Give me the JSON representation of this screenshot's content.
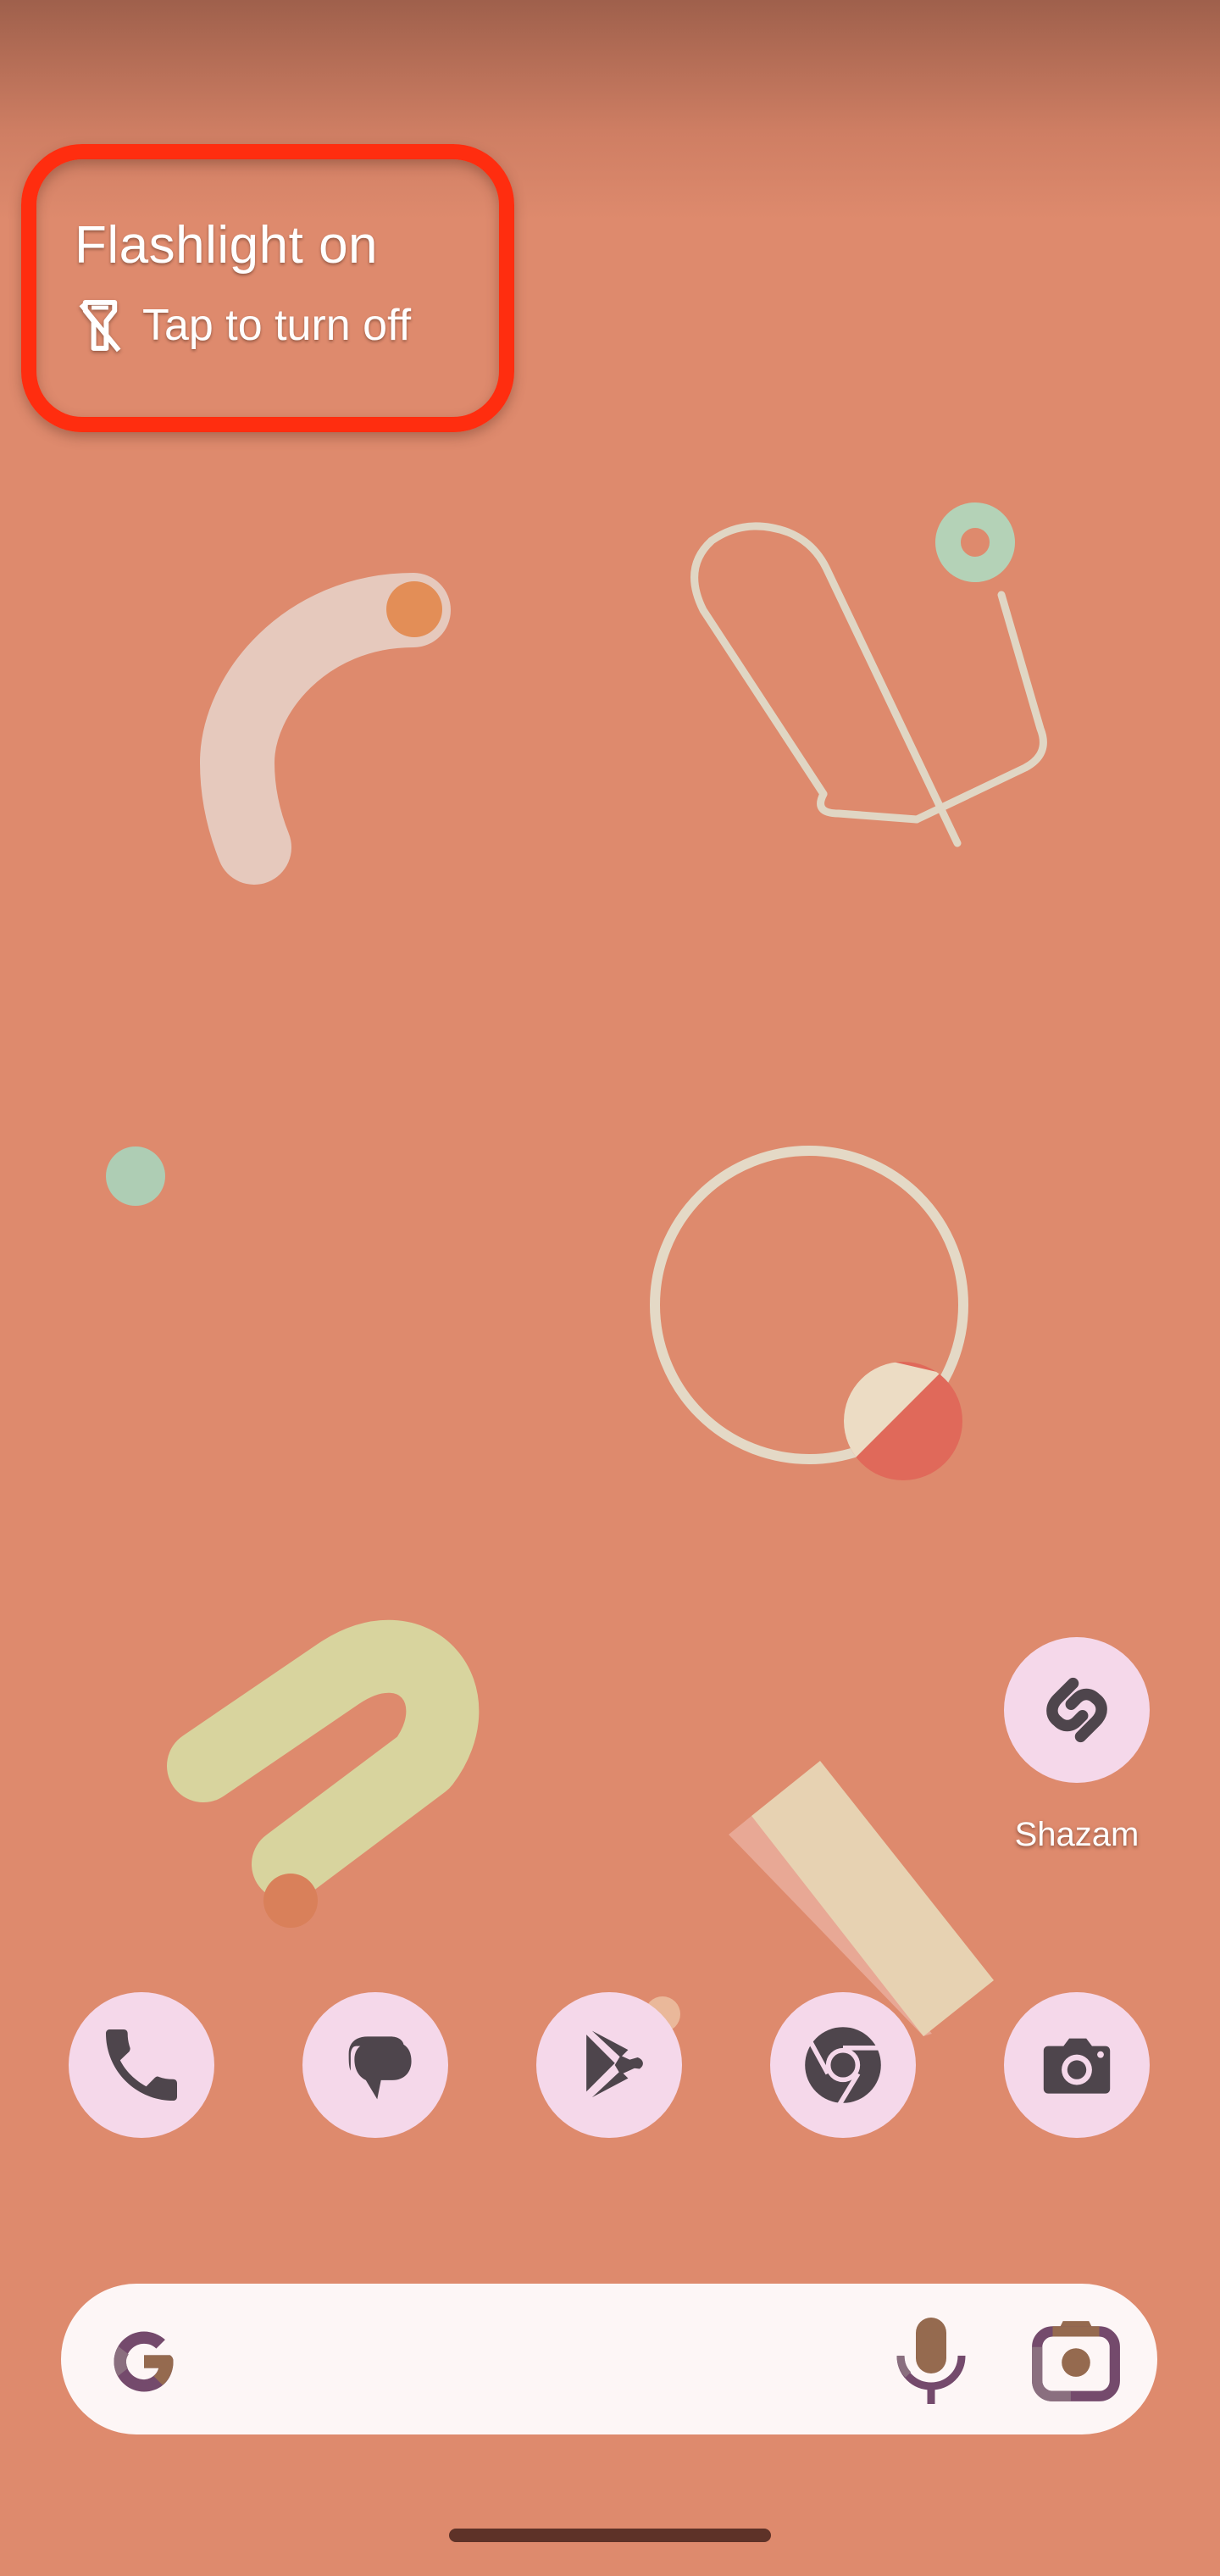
{
  "screen": "Android home screen",
  "colors": {
    "wallpaper_bg": "#de8a6d",
    "highlight_border": "#ff2d0f",
    "icon_bg": "#f5d8ea",
    "icon_fg": "#4e454c",
    "search_bg": "#fdf6f6"
  },
  "notification": {
    "title": "Flashlight on",
    "action_text": "Tap to turn off",
    "icon": "flashlight-off-icon",
    "highlighted": true
  },
  "home_apps": [
    {
      "label": "Shazam",
      "icon": "shazam-icon"
    }
  ],
  "dock": [
    {
      "name": "Phone",
      "icon": "phone-icon"
    },
    {
      "name": "Messages",
      "icon": "messages-icon"
    },
    {
      "name": "Play Store",
      "icon": "play-store-icon"
    },
    {
      "name": "Chrome",
      "icon": "chrome-icon"
    },
    {
      "name": "Camera",
      "icon": "camera-icon"
    }
  ],
  "search_bar": {
    "logo": "google-g-icon",
    "placeholder": "",
    "voice_icon": "microphone-icon",
    "lens_icon": "google-lens-icon"
  },
  "navigation": {
    "gesture_handle": "home-indicator"
  }
}
